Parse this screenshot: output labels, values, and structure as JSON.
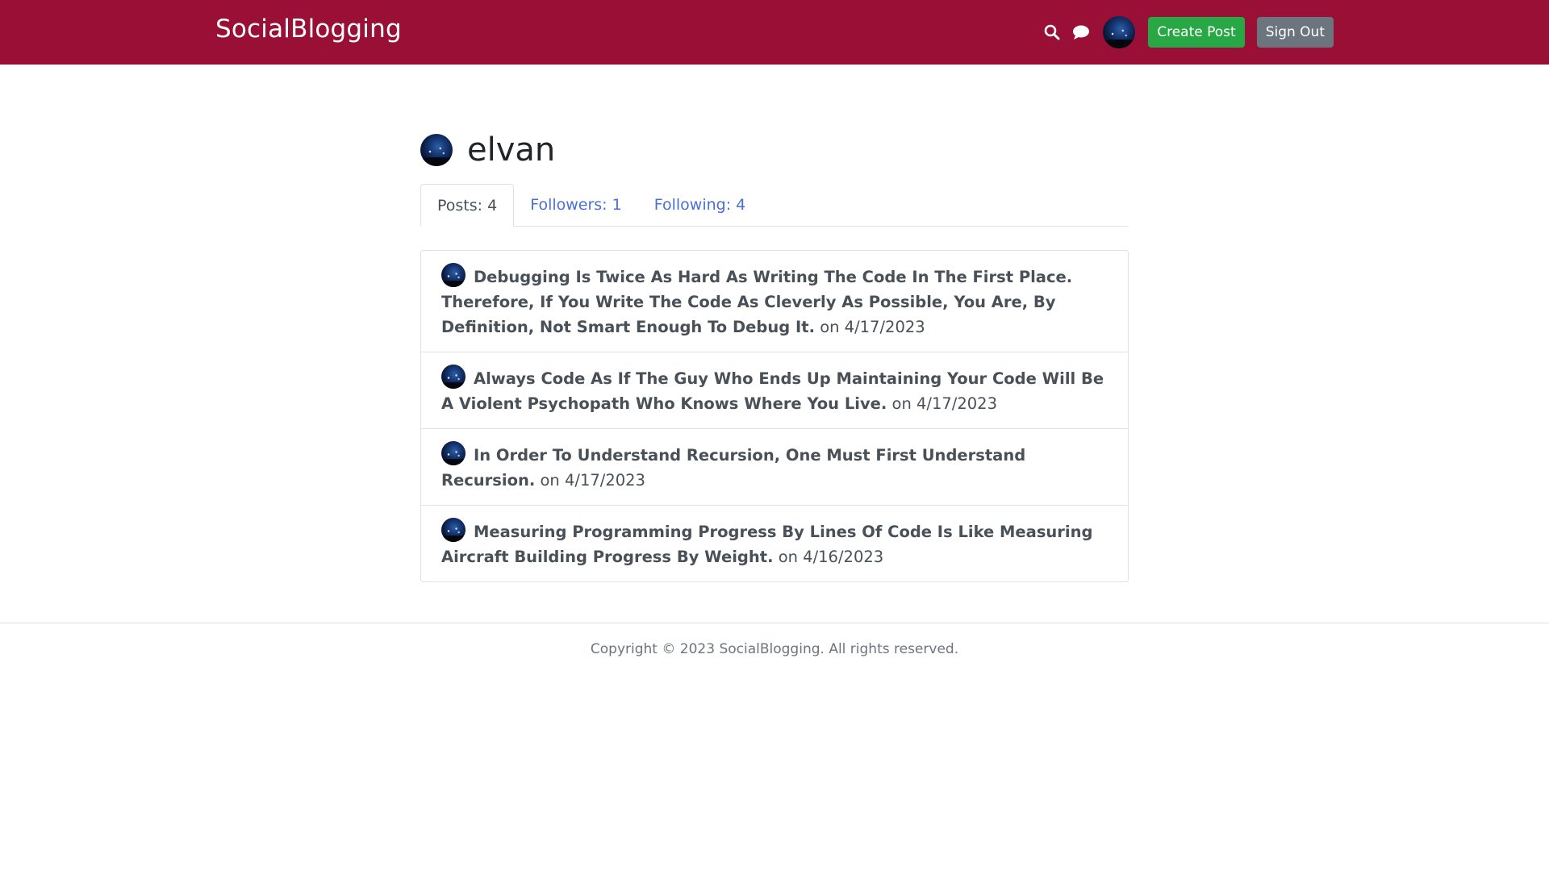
{
  "navbar": {
    "brand": "SocialBlogging",
    "search_icon": "search-icon",
    "messages_icon": "chat-bubble-icon",
    "avatar_icon": "user-avatar",
    "create_post_label": "Create Post",
    "sign_out_label": "Sign Out",
    "background_color": "#990f35"
  },
  "profile": {
    "username": "elvan",
    "tabs": [
      {
        "label": "Posts: 4",
        "active": true
      },
      {
        "label": "Followers: 1",
        "active": false
      },
      {
        "label": "Following: 4",
        "active": false
      }
    ]
  },
  "posts": [
    {
      "title": "Debugging Is Twice As Hard As Writing The Code In The First Place. Therefore, If You Write The Code As Cleverly As Possible, You Are, By Definition, Not Smart Enough To Debug It.",
      "date": "on 4/17/2023"
    },
    {
      "title": "Always Code As If The Guy Who Ends Up Maintaining Your Code Will Be A Violent Psychopath Who Knows Where You Live.",
      "date": "on 4/17/2023"
    },
    {
      "title": "In Order To Understand Recursion, One Must First Understand Recursion.",
      "date": "on 4/17/2023"
    },
    {
      "title": "Measuring Programming Progress By Lines Of Code Is Like Measuring Aircraft Building Progress By Weight.",
      "date": "on 4/16/2023"
    }
  ],
  "footer": {
    "copyright": "Copyright © 2023 SocialBlogging. All rights reserved."
  },
  "colors": {
    "create_button": "#28a745",
    "sign_out_button": "#6c757d",
    "tab_link": "#4a6fd6"
  }
}
